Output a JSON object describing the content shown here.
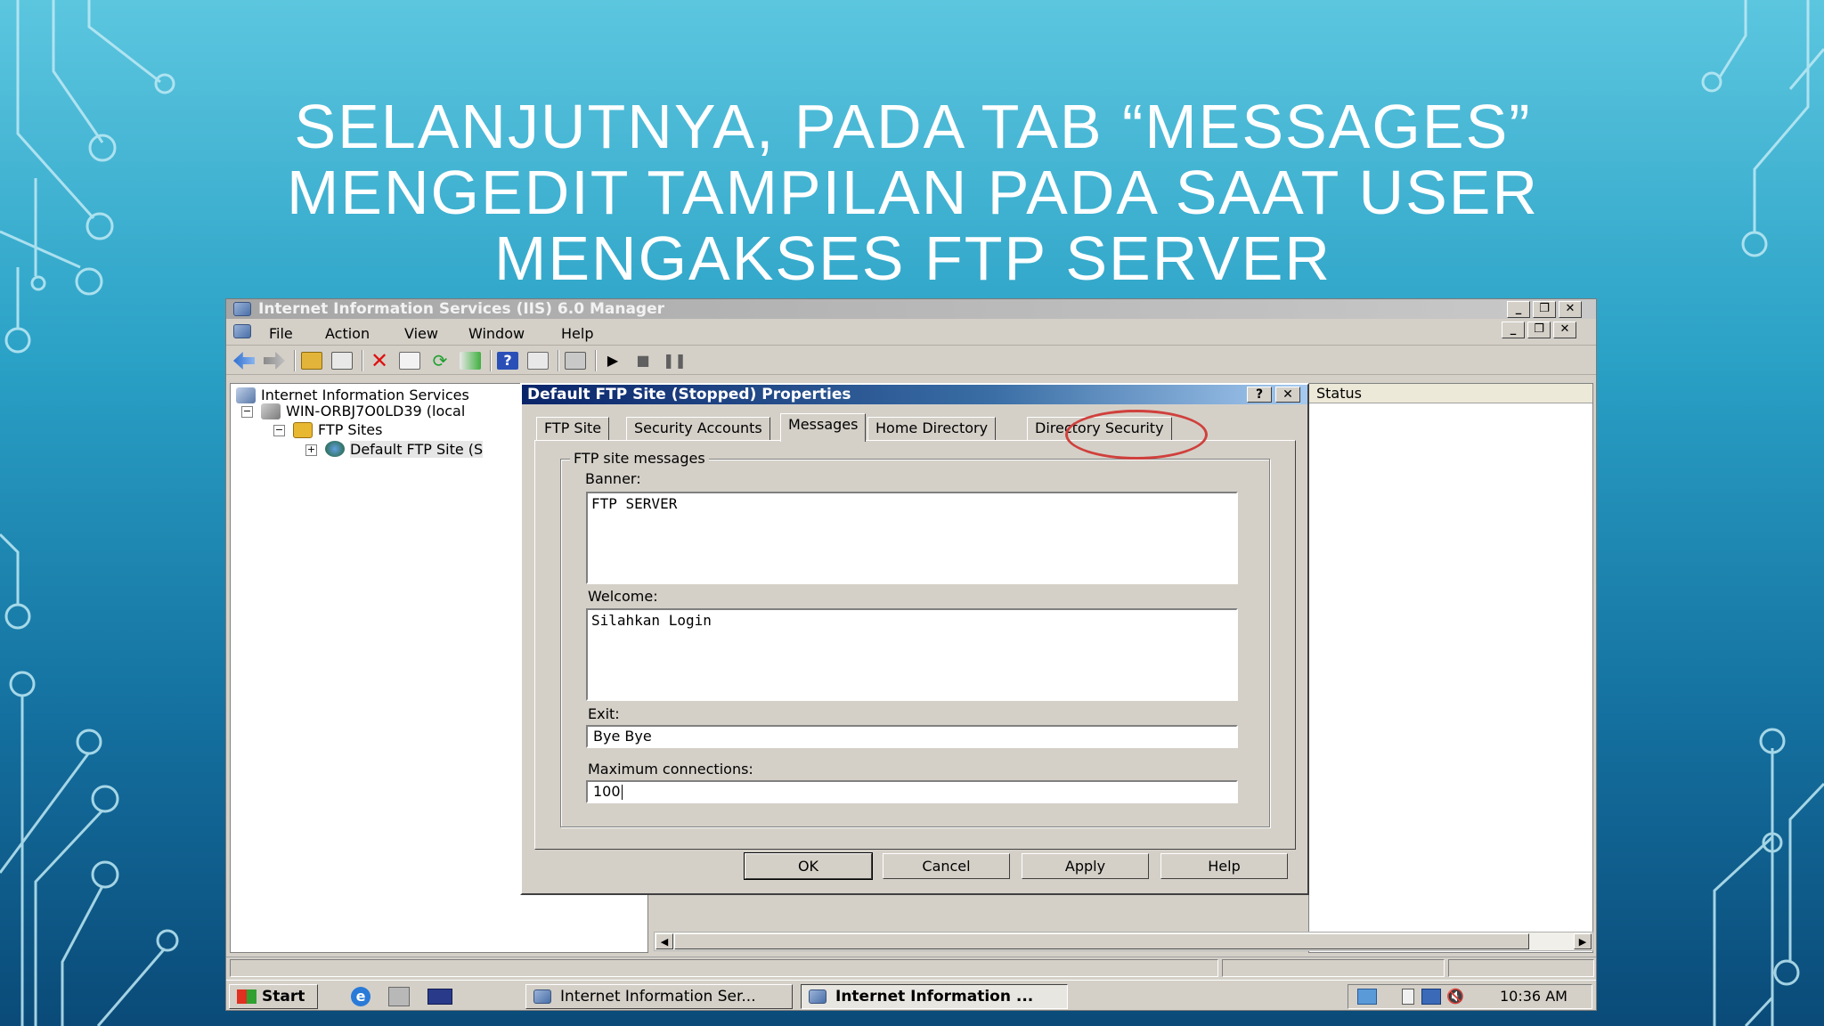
{
  "slide": {
    "title": "SELANJUTNYA, PADA TAB “MESSAGES” MENGEDIT TAMPILAN PADA SAAT USER MENGAKSES FTP SERVER"
  },
  "window": {
    "title": "Internet Information Services (IIS) 6.0 Manager"
  },
  "menu": {
    "items": [
      "File",
      "Action",
      "View",
      "Window",
      "Help"
    ]
  },
  "tree": {
    "root": "Internet Information Services",
    "server": "WIN-ORBJ7O0LD39 (local",
    "ftp_sites": "FTP Sites",
    "default_site": "Default FTP Site (S"
  },
  "right_panel": {
    "status_header": "Status"
  },
  "dialog": {
    "title": "Default FTP Site (Stopped) Properties",
    "help_glyph": "?",
    "close_glyph": "✕",
    "tabs": [
      "FTP Site",
      "Security Accounts",
      "Messages",
      "Home Directory",
      "Directory Security"
    ],
    "active_tab": "Messages",
    "group_label": "FTP site messages",
    "banner_label": "Banner:",
    "banner_value": "FTP SERVER",
    "welcome_label": "Welcome:",
    "welcome_value": "Silahkan Login",
    "exit_label": "Exit:",
    "exit_value": "Bye Bye",
    "max_conn_label": "Maximum connections:",
    "max_conn_value": "100",
    "buttons": {
      "ok": "OK",
      "cancel": "Cancel",
      "apply": "Apply",
      "help": "Help"
    }
  },
  "taskbar": {
    "start": "Start",
    "task1": "Internet Information Ser...",
    "task2": "Internet Information ...",
    "clock": "10:36 AM"
  },
  "colors": {
    "highlight_ring": "#d0403c",
    "dialog_title_start": "#0a246a",
    "window_face": "#d4d0c8"
  }
}
